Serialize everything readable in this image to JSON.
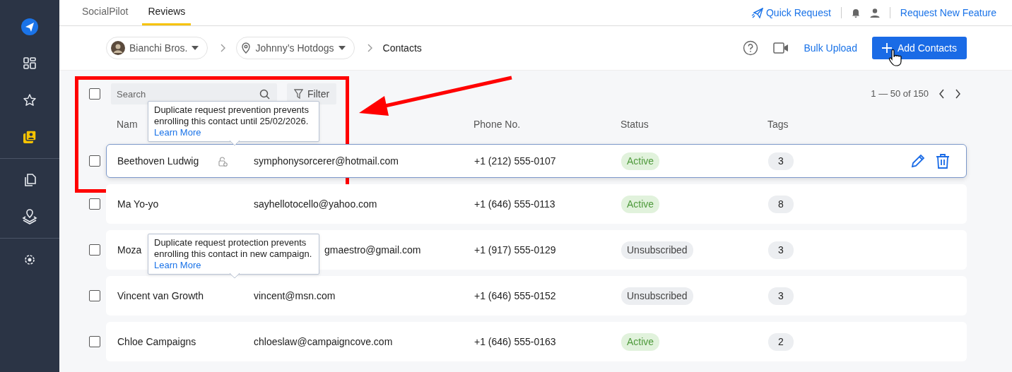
{
  "sidebar": {
    "items": [
      {
        "kind": "logo"
      },
      {
        "kind": "grid",
        "selected": false
      },
      {
        "kind": "star",
        "selected": false
      },
      {
        "kind": "contacts",
        "selected": true,
        "divider_after": true
      },
      {
        "kind": "copy",
        "selected": false
      },
      {
        "kind": "location",
        "selected": false,
        "divider_after": true
      },
      {
        "kind": "gear",
        "selected": false
      }
    ]
  },
  "tabs": [
    {
      "label": "SocialPilot",
      "selected": false
    },
    {
      "label": "Reviews",
      "selected": true
    }
  ],
  "top_links": {
    "quick_request": "Quick Request",
    "request_feature": "Request New Feature"
  },
  "breadcrumb": [
    {
      "kind": "account",
      "label": "Bianchi Bros."
    },
    {
      "kind": "location",
      "label": "Johnny’s Hotdogs"
    },
    {
      "kind": "current",
      "label": "Contacts"
    }
  ],
  "actions": {
    "bulk_upload": "Bulk Upload",
    "add_contacts": "Add Contacts",
    "pointer_cursor": true
  },
  "toolbar": {
    "select_all_checked": false,
    "search_placeholder": "Search",
    "filter": "Filter",
    "pagination": "1 — 50 of 150"
  },
  "table": {
    "columns": [
      "Nam",
      "",
      "Phone No.",
      "Status",
      "Tags"
    ],
    "rows": [
      {
        "checked": false,
        "name": "Beethoven Ludwig",
        "locked": true,
        "email": "symphonysorcerer@hotmail.com",
        "phone": "+1 (212) 555-0107",
        "status": "Active",
        "color": "#e1f2dc",
        "tags": "3",
        "hovered": true,
        "tooltip": "Duplicate request prevention prevents enrolling this contact until 25/02/2026.",
        "tooltip_link": "Learn More"
      },
      {
        "checked": false,
        "name": "Ma Yo-yo",
        "locked": false,
        "email": "sayhellotocello@yahoo.com",
        "phone": "+1 (646) 555-0113",
        "status": "Active",
        "color": "#e1f2dc",
        "tags": "8",
        "hovered": false
      },
      {
        "checked": false,
        "name": "Moza",
        "locked": false,
        "email": "gmaestro@gmail.com",
        "phone": "+1 (917) 555-0129",
        "status": "Unsubscribed",
        "color": "#eceef1",
        "tags": "3",
        "hovered": false,
        "covered": true
      },
      {
        "checked": false,
        "name": "Vincent van Growth",
        "locked": false,
        "email": "vincent@msn.com",
        "phone": "+1 (646) 555-0152",
        "status": "Unsubscribed",
        "color": "#eceef1",
        "tags": "3",
        "hovered": false,
        "tooltip": "Duplicate request protection prevents enrolling this contact in new campaign.",
        "tooltip_link": "Learn More"
      },
      {
        "checked": false,
        "name": "Chloe Campaigns",
        "locked": false,
        "email": "chloeslaw@campaigncove.com",
        "phone": "+1 (646) 555-0163",
        "status": "Active",
        "color": "#e1f2dc",
        "tags": "2",
        "hovered": false
      }
    ]
  },
  "annotations": {
    "highlight_box": true,
    "arrow": true
  }
}
